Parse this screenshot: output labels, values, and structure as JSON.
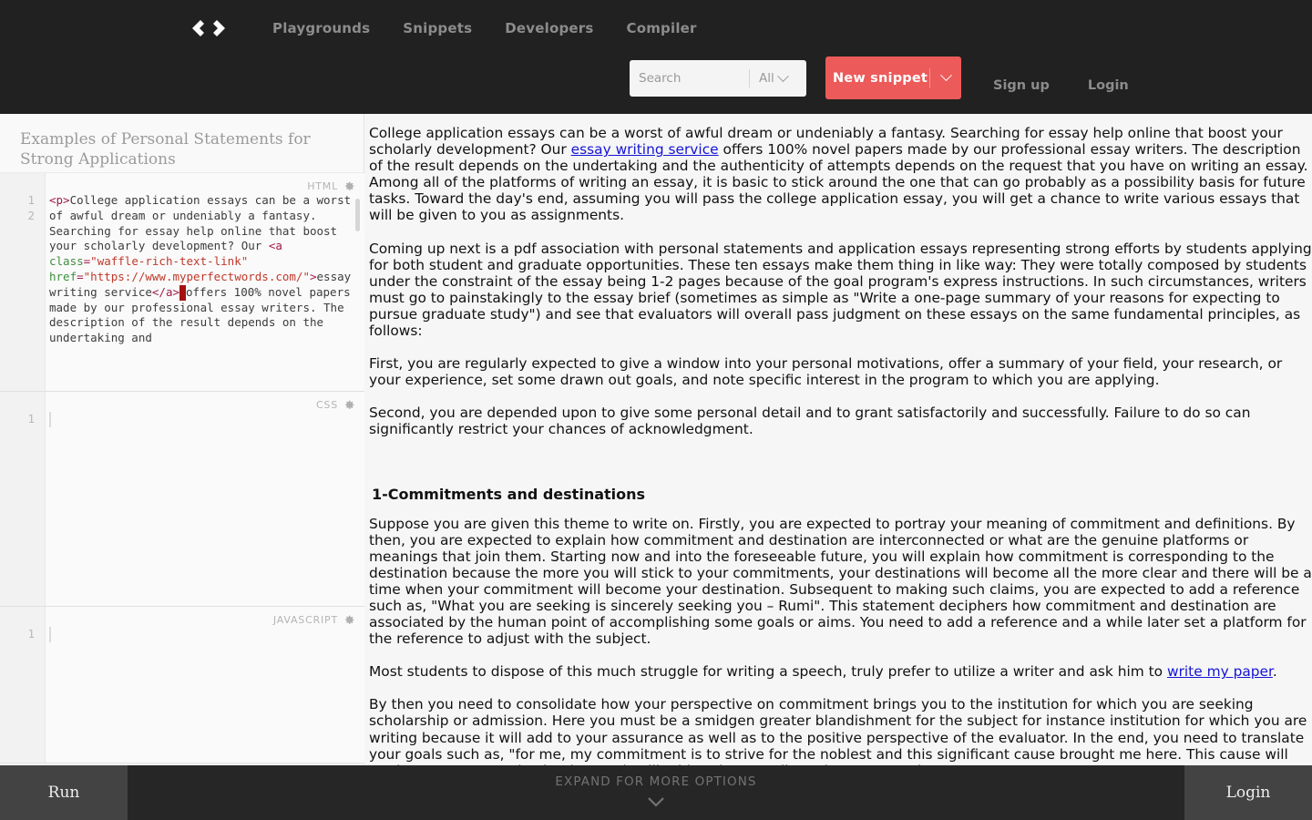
{
  "header": {
    "logo_icon": "code-brackets-logo",
    "nav": [
      {
        "label": "Playgrounds"
      },
      {
        "label": "Snippets"
      },
      {
        "label": "Developers"
      },
      {
        "label": "Compiler"
      }
    ],
    "search": {
      "placeholder": "Search",
      "value": "",
      "scope_label": "All",
      "scope_caret_icon": "chevron-down-icon"
    },
    "new_snippet": {
      "label": "New snippet",
      "caret_icon": "chevron-down-icon",
      "accent_color": "#ec5a5a"
    },
    "auth": [
      {
        "label": "Sign up"
      },
      {
        "label": "Login"
      }
    ],
    "background_color": "#212121"
  },
  "left_pane": {
    "snippet_title": "Examples of Personal Statements for Strong Applications",
    "editors": [
      {
        "language_label": "HTML",
        "settings_icon": "gear-icon",
        "line_numbers": [
          "1",
          "2"
        ],
        "code_segments": [
          {
            "t": "tag",
            "v": "<p>"
          },
          {
            "t": "text",
            "v": "College application essays can be a worst of awful dream or undeniably a fantasy. Searching for essay help online that boost your scholarly development? Our "
          },
          {
            "t": "tag",
            "v": "<a "
          },
          {
            "t": "attr",
            "v": "class"
          },
          {
            "t": "tag",
            "v": "="
          },
          {
            "t": "val",
            "v": "\"waffle-rich-text-link\""
          },
          {
            "t": "text",
            "v": " "
          },
          {
            "t": "attr",
            "v": "href"
          },
          {
            "t": "tag",
            "v": "="
          },
          {
            "t": "val",
            "v": "\"https://www.myperfectwords.com/\""
          },
          {
            "t": "tag",
            "v": ">"
          },
          {
            "t": "text",
            "v": "essay writing service"
          },
          {
            "t": "tag",
            "v": "</a>"
          },
          {
            "t": "bad",
            "v": " "
          },
          {
            "t": "text",
            "v": "offers 100% novel papers made by our professional essay writers. The description of the result depends on the undertaking and"
          }
        ]
      },
      {
        "language_label": "CSS",
        "settings_icon": "gear-icon",
        "line_numbers": [
          "1"
        ],
        "code_segments": []
      },
      {
        "language_label": "JAVASCRIPT",
        "settings_icon": "gear-icon",
        "line_numbers": [
          "1"
        ],
        "code_segments": []
      }
    ]
  },
  "content": {
    "blocks": [
      {
        "type": "p",
        "runs": [
          {
            "t": "text",
            "v": "College application essays can be a worst of awful dream or undeniably a fantasy. Searching for essay help online that boost your scholarly development? Our "
          },
          {
            "t": "link",
            "v": "essay writing service"
          },
          {
            "t": "text",
            "v": " offers 100% novel papers made by our professional essay writers. The description of the result depends on the undertaking and the authenticity of attempts depends on the request that you have on writing an essay. Among all of the platforms of writing an essay, it is basic to stick around the one that can go probably as a possibility basis for future tasks. Toward the day's end, assuming you will pass the college application essay, you will get a chance to write various essays that will be given to you as assignments."
          }
        ]
      },
      {
        "type": "p",
        "runs": [
          {
            "t": "text",
            "v": "Coming up next is a pdf association with personal statements and application essays representing strong efforts by students applying for both student and graduate opportunities. These ten essays make them thing in like way: They were totally composed by students under the constraint of the essay being 1-2 pages because of the goal program's express instructions. In such circumstances, writers must go to painstakingly to the essay brief (sometimes as simple as \"Write a one-page summary of your reasons for expecting to pursue graduate study\") and see that evaluators will overall pass judgment on these essays on the same fundamental principles, as follows:"
          }
        ]
      },
      {
        "type": "p",
        "runs": [
          {
            "t": "text",
            "v": "First, you are regularly expected to give a window into your personal motivations, offer a summary of your field, your research, or your experience, set some drawn out goals, and note specific interest in the program to which you are applying."
          }
        ]
      },
      {
        "type": "p",
        "runs": [
          {
            "t": "text",
            "v": "Second, you are depended upon to give some personal detail and to grant satisfactorily and successfully. Failure to do so can significantly restrict your chances of acknowledgment."
          }
        ]
      },
      {
        "type": "spacer",
        "runs": []
      },
      {
        "type": "h3",
        "runs": [
          {
            "t": "text",
            "v": "1-Commitments and destinations"
          }
        ]
      },
      {
        "type": "p",
        "runs": [
          {
            "t": "text",
            "v": "Suppose you are given this theme to write on. Firstly, you are expected to portray your meaning of commitment and definitions. By then, you are expected to explain how commitment and destination are interconnected or what are the genuine platforms or meanings that join them. Starting now and into the foreseeable future, you will explain how commitment is corresponding to the destination because the more you will stick to your commitments, your destinations will become all the more clear and there will be a time when your commitment will become your destination. Subsequent to making such claims, you are expected to add a reference such as, \"What you are seeking is sincerely seeking you – Rumi\". This statement deciphers how commitment and destination are associated by the human point of accomplishing some goals or aims. You need to add a reference and a while later set a platform for the reference to adjust with the subject."
          }
        ]
      },
      {
        "type": "p",
        "runs": [
          {
            "t": "text",
            "v": "Most students to dispose of this much struggle for writing a speech, truly prefer to utilize a writer and ask him to "
          },
          {
            "t": "link",
            "v": "write my paper"
          },
          {
            "t": "text",
            "v": "."
          }
        ]
      },
      {
        "type": "p",
        "runs": [
          {
            "t": "text",
            "v": "By then you need to consolidate how your perspective on commitment brings you to the institution for which you are seeking scholarship or admission. Here you must be a smidgen greater blandishment for the subject for instance institution for which you are writing because it will add to your assurance as well as to the positive perspective of the evaluator. In the end, you need to translate your goals such as, \"for me, my commitment is to strive for the noblest and this significant cause brought me here. This cause will not just ease up my destination yet it will add to the overall employment worth\"."
          }
        ]
      }
    ],
    "link_color": "#1414d6"
  },
  "bottom_bar": {
    "run_label": "Run",
    "expand_label": "EXPAND FOR MORE OPTIONS",
    "expand_caret_icon": "chevron-down-icon",
    "login_label": "Login",
    "background_color": "#262626"
  }
}
